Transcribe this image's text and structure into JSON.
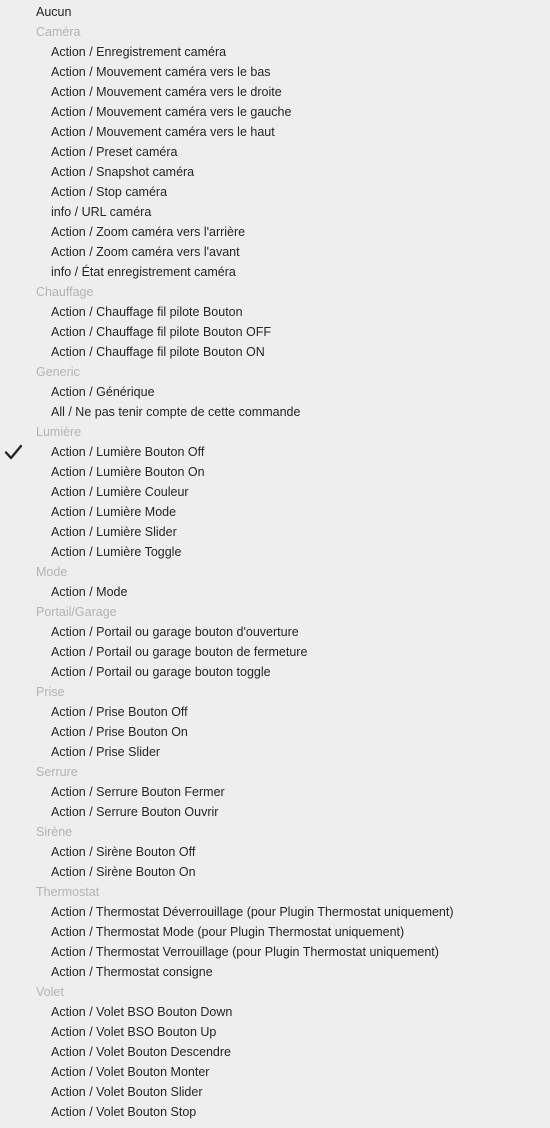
{
  "menu": {
    "none_label": "Aucun",
    "selected": "Action / Lumière Bouton Off",
    "colors": {
      "text": "#262626",
      "group": "#b3b3b3",
      "background": "#eeeeee"
    },
    "groups": [
      {
        "label": "Caméra",
        "items": [
          "Action / Enregistrement caméra",
          "Action / Mouvement caméra vers le bas",
          "Action / Mouvement caméra vers le droite",
          "Action / Mouvement caméra vers le gauche",
          "Action / Mouvement caméra vers le haut",
          "Action / Preset caméra",
          "Action / Snapshot caméra",
          "Action / Stop caméra",
          "info / URL caméra",
          "Action / Zoom caméra vers l'arrière",
          "Action / Zoom caméra vers l'avant",
          "info / État enregistrement caméra"
        ]
      },
      {
        "label": "Chauffage",
        "items": [
          "Action / Chauffage fil pilote Bouton",
          "Action / Chauffage fil pilote Bouton OFF",
          "Action / Chauffage fil pilote Bouton ON"
        ]
      },
      {
        "label": "Generic",
        "items": [
          "Action / Générique",
          "All / Ne pas tenir compte de cette commande"
        ]
      },
      {
        "label": "Lumière",
        "items": [
          "Action / Lumière Bouton Off",
          "Action / Lumière Bouton On",
          "Action / Lumière Couleur",
          "Action / Lumière Mode",
          "Action / Lumière Slider",
          "Action / Lumière Toggle"
        ]
      },
      {
        "label": "Mode",
        "items": [
          "Action / Mode"
        ]
      },
      {
        "label": "Portail/Garage",
        "items": [
          "Action / Portail ou garage bouton d'ouverture",
          "Action / Portail ou garage bouton de fermeture",
          "Action / Portail ou garage bouton toggle"
        ]
      },
      {
        "label": "Prise",
        "items": [
          "Action / Prise Bouton Off",
          "Action / Prise Bouton On",
          "Action / Prise Slider"
        ]
      },
      {
        "label": "Serrure",
        "items": [
          "Action / Serrure Bouton Fermer",
          "Action / Serrure Bouton Ouvrir"
        ]
      },
      {
        "label": "Sirène",
        "items": [
          "Action / Sirène Bouton Off",
          "Action / Sirène Bouton On"
        ]
      },
      {
        "label": "Thermostat",
        "items": [
          "Action / Thermostat Déverrouillage (pour Plugin Thermostat uniquement)",
          "Action / Thermostat Mode (pour Plugin Thermostat uniquement)",
          "Action / Thermostat Verrouillage (pour Plugin Thermostat uniquement)",
          "Action / Thermostat consigne"
        ]
      },
      {
        "label": "Volet",
        "items": [
          "Action / Volet BSO Bouton Down",
          "Action / Volet BSO Bouton Up",
          "Action / Volet Bouton Descendre",
          "Action / Volet Bouton Monter",
          "Action / Volet Bouton Slider",
          "Action / Volet Bouton Stop"
        ]
      }
    ]
  }
}
